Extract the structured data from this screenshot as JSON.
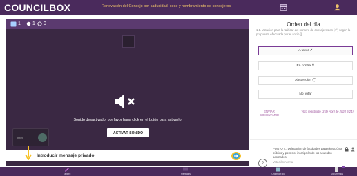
{
  "header": {
    "logo": "COUNCILBOX",
    "title": "Renovación del Consejo por caducidad; cese y nombramiento de consejeros"
  },
  "video": {
    "counters": [
      {
        "icon": "users-icon",
        "value": "1"
      },
      {
        "icon": "hand-icon",
        "value": "1"
      },
      {
        "icon": "clock-icon",
        "value": "0"
      }
    ],
    "muted_text": "Sonido desactivado, por favor haga click en el botón para activarlo",
    "activate_button": "ACTIVAR SONIDO",
    "mini_label": "Intelí",
    "message_placeholder": "Introducir mensaje privado"
  },
  "agenda": {
    "title": "Orden del día",
    "description": "1.1. Votación para la ratificar del número de consejeros en [n°] según la propuesta efectuada por el socio [].",
    "options": [
      {
        "label": "A favor ✔",
        "selected": true
      },
      {
        "label": "En contra ✕",
        "selected": false
      },
      {
        "label": "Abstención ◯",
        "selected": false
      },
      {
        "label": "No votar",
        "selected": false
      }
    ],
    "send_comment": "ENVIAR COMENTARIO",
    "vote_registered": "Voto registrado (3 de Abril de 2020 9:24)",
    "next_item": {
      "number": "2",
      "text": "PUNTO 2.: Delegación de facultades para elevación a público y posterior inscripción de los acuerdos adoptados.",
      "type": "Votación normal"
    }
  },
  "bottom_nav": [
    {
      "label": "Tablero",
      "icon": "pen-icon"
    },
    {
      "label": "Mensajes",
      "icon": "chat-icon"
    },
    {
      "label": "Orden del día",
      "icon": "calendar-icon"
    },
    {
      "label": "Documentos",
      "icon": "document-icon"
    }
  ],
  "colors": {
    "brand": "#4a2a5c",
    "accent": "#7a3b96",
    "title_text": "#f0c46a",
    "video_bg": "#3a2843"
  }
}
